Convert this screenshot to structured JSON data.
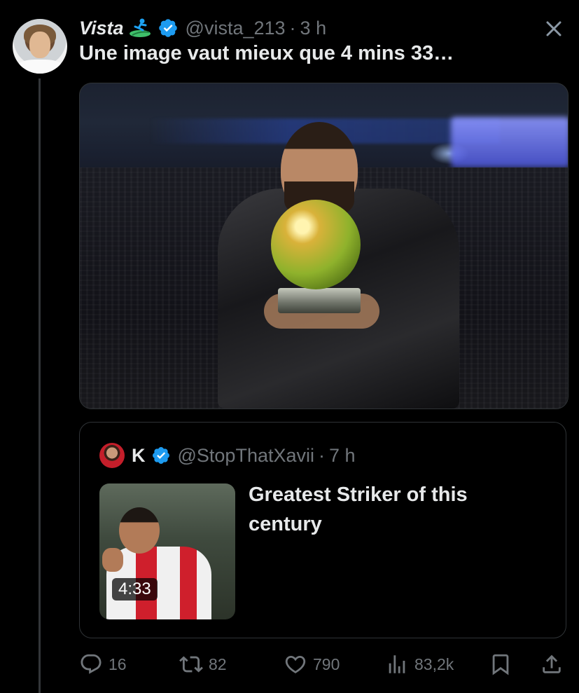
{
  "tweet": {
    "author_name": "Vista",
    "handle": "@vista_213",
    "separator": "·",
    "time": "3 h",
    "text": "Une image vaut mieux que 4 mins 33…",
    "verified_color": "#1d9bf0"
  },
  "quoted": {
    "author_name": "K",
    "handle": "@StopThatXavii",
    "separator": "·",
    "time": "7 h",
    "text": "Greatest Striker of this century",
    "video_duration": "4:33"
  },
  "actions": {
    "replies": "16",
    "retweets": "82",
    "likes": "790",
    "views": "83,2k"
  },
  "icons": [
    "close-icon",
    "verified-icon",
    "reply-icon",
    "retweet-icon",
    "like-icon",
    "views-icon",
    "bookmark-icon",
    "share-icon"
  ],
  "colors": {
    "background": "#000000",
    "text": "#e7e9ea",
    "muted": "#71767b",
    "border": "#2f3336",
    "accent": "#1d9bf0"
  }
}
